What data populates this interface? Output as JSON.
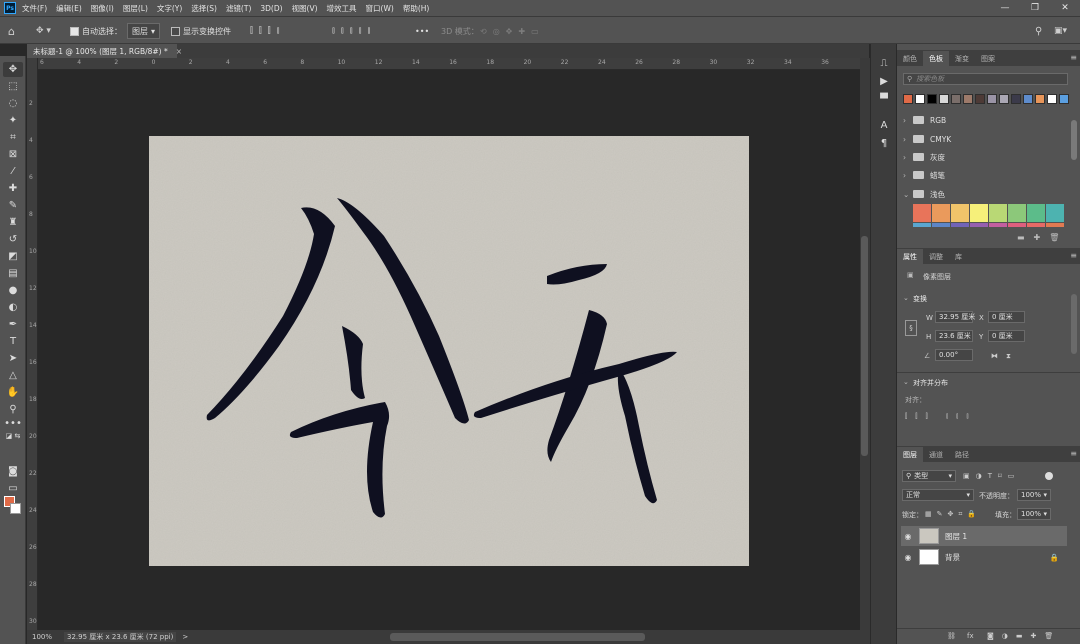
{
  "app": {
    "logo": "Ps",
    "menu": [
      "文件(F)",
      "编辑(E)",
      "图像(I)",
      "图层(L)",
      "文字(Y)",
      "选择(S)",
      "滤镜(T)",
      "3D(D)",
      "视图(V)",
      "增效工具",
      "窗口(W)",
      "帮助(H)"
    ],
    "window_controls": [
      "minimize-icon",
      "restore-icon",
      "close-icon"
    ]
  },
  "options": {
    "auto_select_label": "自动选择：",
    "auto_select_checked": true,
    "auto_select_target": "图层",
    "show_transform_label": "显示变换控件",
    "show_transform_checked": false,
    "more": "•••",
    "mode_3d": "3D 模式："
  },
  "document": {
    "tab_title": "未标题-1 @ 100% (图层 1, RGB/8#) *",
    "close": "×",
    "zoom": "100%",
    "status": "32.95 厘米 x 23.6 厘米 (72 ppi)",
    "status_arrow": ">"
  },
  "ruler": {
    "h_ticks": [
      "6",
      "4",
      "2",
      "0",
      "2",
      "4",
      "6",
      "8",
      "10",
      "12",
      "14",
      "16",
      "18",
      "20",
      "22",
      "24",
      "26",
      "28",
      "30",
      "32",
      "34",
      "36"
    ],
    "v_ticks": [
      "2",
      "4",
      "6",
      "8",
      "10",
      "12",
      "14",
      "16",
      "18",
      "20",
      "22",
      "24",
      "26",
      "28",
      "30"
    ]
  },
  "swatches_panel": {
    "tabs": [
      "颜色",
      "色板",
      "渐变",
      "图案"
    ],
    "active_tab": "色板",
    "search_placeholder": "搜索色板",
    "recent_colors": [
      "#e06a47",
      "#ffffff",
      "#000000",
      "#d8d8d8",
      "#7a6e6a",
      "#9d7a6a",
      "#4d3a36",
      "#9a94a6",
      "#aaa7b4",
      "#3b3a4a",
      "#5e8ccc",
      "#e8965a",
      "#ffffff",
      "#5b9fe0"
    ],
    "groups": [
      {
        "name": "RGB",
        "expanded": false
      },
      {
        "name": "CMYK",
        "expanded": false
      },
      {
        "name": "灰度",
        "expanded": false
      },
      {
        "name": "蜡笔",
        "expanded": false
      },
      {
        "name": "浅色",
        "expanded": true
      }
    ],
    "light_colors": [
      "#e8745a",
      "#ea9a5c",
      "#f0c46a",
      "#f6f07a",
      "#b9d875",
      "#8cc87a",
      "#5cbc8a",
      "#4db3b0"
    ],
    "light_colors_row2": [
      "#5aa6d0",
      "#5d86c8",
      "#7264b8",
      "#9660b0",
      "#c35fa0",
      "#de5f7e",
      "#e66a66",
      "#e07a52"
    ]
  },
  "properties_panel": {
    "tabs": [
      "属性",
      "调整",
      "库"
    ],
    "active_tab": "属性",
    "layer_kind": "像素图层",
    "transform_title": "变换",
    "w_label": "W",
    "w_value": "32.95 厘米",
    "x_label": "X",
    "x_value": "0 厘米",
    "h_label": "H",
    "h_value": "23.6 厘米",
    "y_label": "Y",
    "y_value": "0 厘米",
    "angle_value": "0.00°",
    "align_title": "对齐并分布",
    "align_label": "对齐："
  },
  "layers_panel": {
    "tabs": [
      "图层",
      "通道",
      "路径"
    ],
    "active_tab": "图层",
    "filter_kind": "类型",
    "blend_mode": "正常",
    "opacity_label": "不透明度：",
    "opacity_value": "100%",
    "lock_label": "锁定：",
    "fill_label": "填充：",
    "fill_value": "100%",
    "layers": [
      {
        "name": "图层 1",
        "selected": true,
        "visible": true
      },
      {
        "name": "背景",
        "selected": false,
        "visible": true,
        "locked": true
      }
    ],
    "footer_fx": "fx"
  }
}
